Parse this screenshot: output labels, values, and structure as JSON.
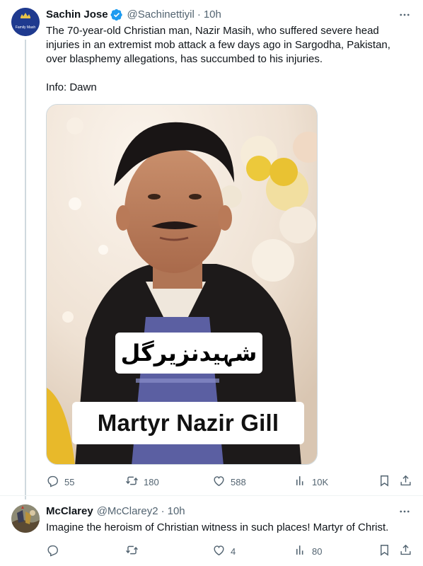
{
  "tweets": [
    {
      "author": {
        "name": "Sachin Jose",
        "handle": "@Sachinettiyil",
        "verified": true,
        "avatar_text": "Family Mash",
        "avatar_color": "#223a8a"
      },
      "time": "10h",
      "text_lines": [
        "The 70-year-old Christian man, Nazir Masih, who suffered severe head",
        "injuries in an extremist mob attack a few days ago in Sargodha, Pakistan,",
        "over blasphemy allegations, has succumbed to his injuries."
      ],
      "text_footer": "Info: Dawn",
      "media": {
        "caption_urdu": "شہیدنزیرگل",
        "caption_english": "Martyr Nazir Gill"
      },
      "actions": {
        "replies": "55",
        "reposts": "180",
        "likes": "588",
        "views": "10K"
      }
    },
    {
      "author": {
        "name": "McClarey",
        "handle": "@McClarey2",
        "verified": false
      },
      "time": "10h",
      "text_lines": [
        "Imagine the heroism of Christian witness in such places! Martyr of Christ."
      ],
      "actions": {
        "replies": "",
        "reposts": "",
        "likes": "4",
        "views": "80"
      }
    }
  ],
  "colors": {
    "text": "#0f1419",
    "secondary": "#536471",
    "verified_blue": "#1d9bf0",
    "border": "#cfd9de"
  }
}
